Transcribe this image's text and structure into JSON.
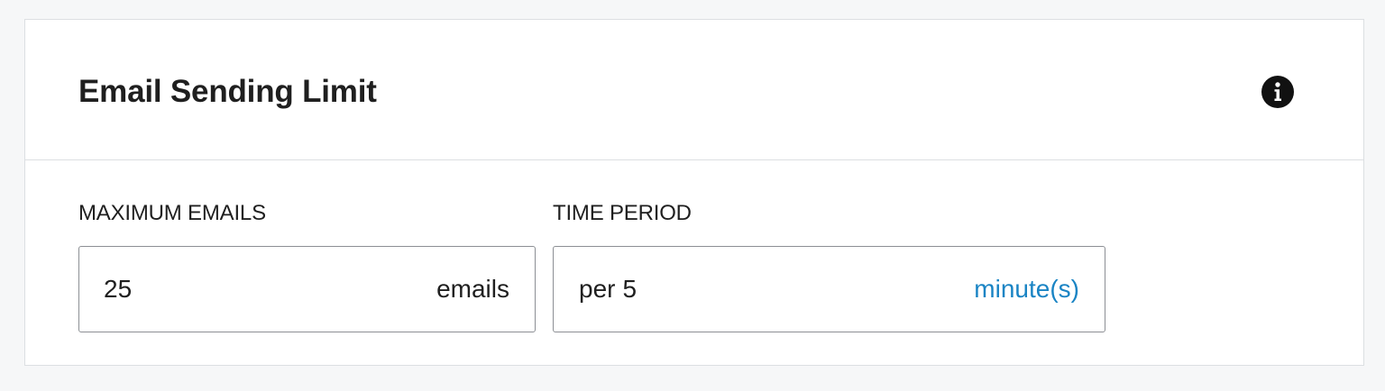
{
  "card": {
    "title": "Email Sending Limit",
    "info_icon": "info-circle-icon"
  },
  "max_emails": {
    "label": "MAXIMUM EMAILS",
    "value": "25",
    "suffix": "emails"
  },
  "time_period": {
    "label": "TIME PERIOD",
    "prefix": "per",
    "value": "5",
    "unit": "minute(s)"
  },
  "colors": {
    "link": "#1a84c4",
    "border": "#8c8f94",
    "page_background": "#f6f7f8"
  }
}
